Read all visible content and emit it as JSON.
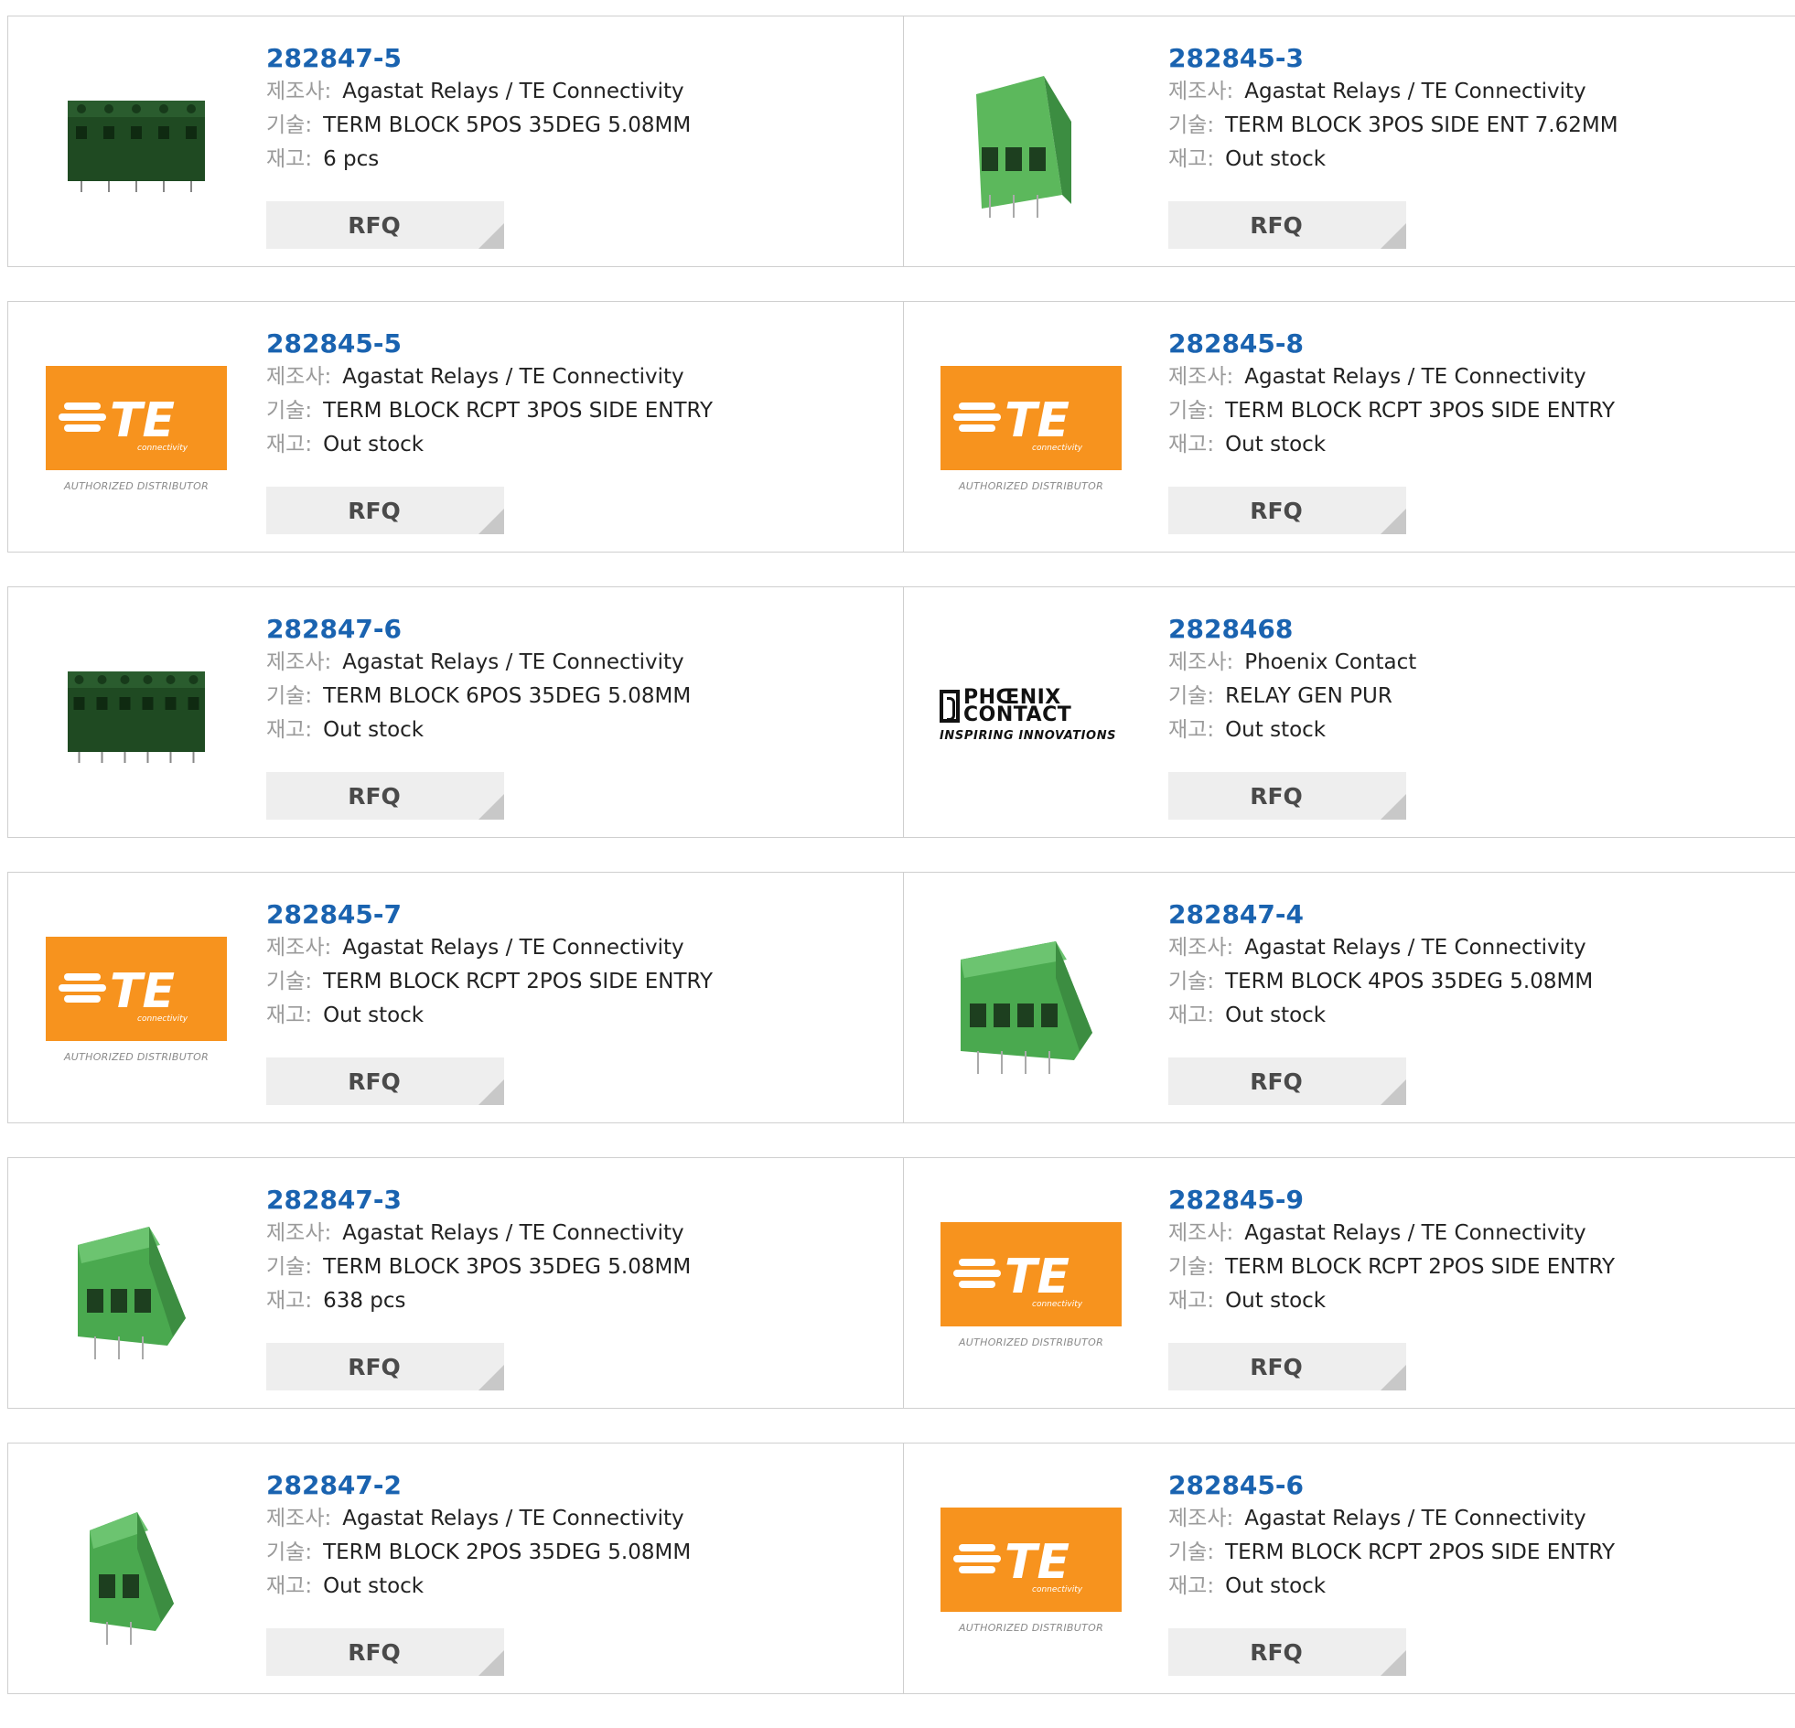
{
  "labels": {
    "manufacturer": "제조사:",
    "description": "기술:",
    "stock": "재고:"
  },
  "rfq_label": "RFQ",
  "logos": {
    "te_wordmark": "TE",
    "te_sub": "connectivity",
    "te_distributor": "AUTHORIZED DISTRIBUTOR",
    "phoenix_line1": "PHŒNIX",
    "phoenix_line2": "CONTACT",
    "phoenix_tagline": "INSPIRING INNOVATIONS"
  },
  "colors": {
    "part_link": "#1a63b0",
    "te_orange": "#f7931e",
    "connector_green": "#5cb85c",
    "connector_dark": "#1f4a22"
  },
  "products": [
    {
      "part": "282847-5",
      "manufacturer": "Agastat Relays / TE Connectivity",
      "description": "TERM BLOCK 5POS 35DEG 5.08MM",
      "stock": "6 pcs",
      "image": "dark-terminal-block-5pos"
    },
    {
      "part": "282845-3",
      "manufacturer": "Agastat Relays / TE Connectivity",
      "description": "TERM BLOCK 3POS SIDE ENT 7.62MM",
      "stock": "Out stock",
      "image": "green-terminal-block-3pos"
    },
    {
      "part": "282845-5",
      "manufacturer": "Agastat Relays / TE Connectivity",
      "description": "TERM BLOCK RCPT 3POS SIDE ENTRY",
      "stock": "Out stock",
      "image": "te-logo"
    },
    {
      "part": "282845-8",
      "manufacturer": "Agastat Relays / TE Connectivity",
      "description": "TERM BLOCK RCPT 3POS SIDE ENTRY",
      "stock": "Out stock",
      "image": "te-logo"
    },
    {
      "part": "282847-6",
      "manufacturer": "Agastat Relays / TE Connectivity",
      "description": "TERM BLOCK 6POS 35DEG 5.08MM",
      "stock": "Out stock",
      "image": "dark-terminal-block-6pos"
    },
    {
      "part": "2828468",
      "manufacturer": "Phoenix Contact",
      "description": "RELAY GEN PUR",
      "stock": "Out stock",
      "image": "phoenix-logo"
    },
    {
      "part": "282845-7",
      "manufacturer": "Agastat Relays / TE Connectivity",
      "description": "TERM BLOCK RCPT 2POS SIDE ENTRY",
      "stock": "Out stock",
      "image": "te-logo"
    },
    {
      "part": "282847-4",
      "manufacturer": "Agastat Relays / TE Connectivity",
      "description": "TERM BLOCK 4POS 35DEG 5.08MM",
      "stock": "Out stock",
      "image": "green-terminal-block-4pos"
    },
    {
      "part": "282847-3",
      "manufacturer": "Agastat Relays / TE Connectivity",
      "description": "TERM BLOCK 3POS 35DEG 5.08MM",
      "stock": "638 pcs",
      "image": "green-terminal-block-3pos-angled"
    },
    {
      "part": "282845-9",
      "manufacturer": "Agastat Relays / TE Connectivity",
      "description": "TERM BLOCK RCPT 2POS SIDE ENTRY",
      "stock": "Out stock",
      "image": "te-logo"
    },
    {
      "part": "282847-2",
      "manufacturer": "Agastat Relays / TE Connectivity",
      "description": "TERM BLOCK 2POS 35DEG 5.08MM",
      "stock": "Out stock",
      "image": "green-terminal-block-2pos"
    },
    {
      "part": "282845-6",
      "manufacturer": "Agastat Relays / TE Connectivity",
      "description": "TERM BLOCK RCPT 2POS SIDE ENTRY",
      "stock": "Out stock",
      "image": "te-logo"
    }
  ]
}
